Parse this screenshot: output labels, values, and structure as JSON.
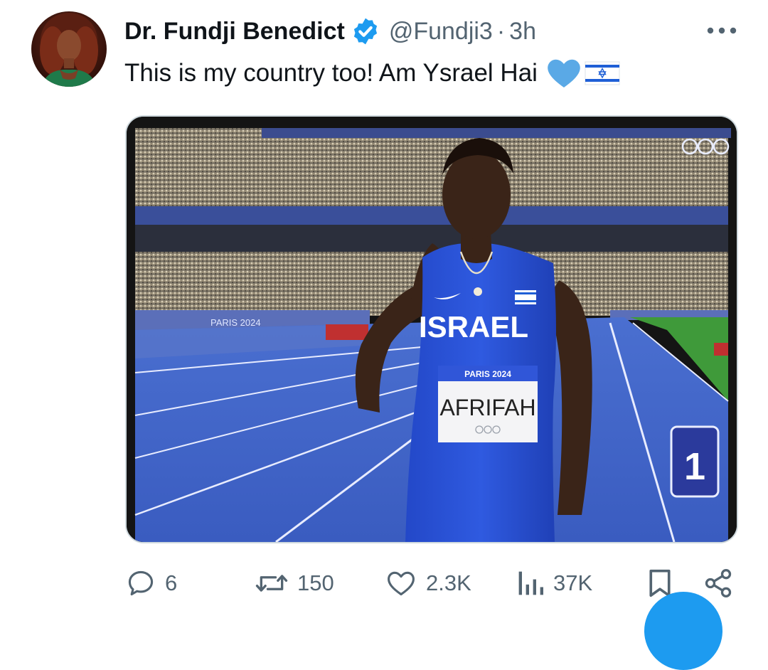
{
  "tweet": {
    "author": {
      "display_name": "Dr. Fundji Benedict",
      "handle": "@Fundji3",
      "verified": true
    },
    "separator": "·",
    "time": "3h",
    "text": "This is my country too! Am Ysrael Hai",
    "emojis": [
      "blue-heart",
      "israel-flag"
    ],
    "media": {
      "type": "photo",
      "jersey_text": "ISRAEL",
      "bib_event": "PARIS 2024",
      "bib_name": "AFRIFAH",
      "lane_number": "1",
      "banner_text": "PARIS 2024"
    },
    "actions": {
      "replies": "6",
      "retweets": "150",
      "likes": "2.3K",
      "views": "37K"
    }
  },
  "colors": {
    "verified": "#1d9bf0",
    "text": "#0f1419",
    "secondary": "#536471",
    "heart": "#5aa9e6",
    "track": "#3f64c8",
    "jersey": "#2c56d8"
  }
}
